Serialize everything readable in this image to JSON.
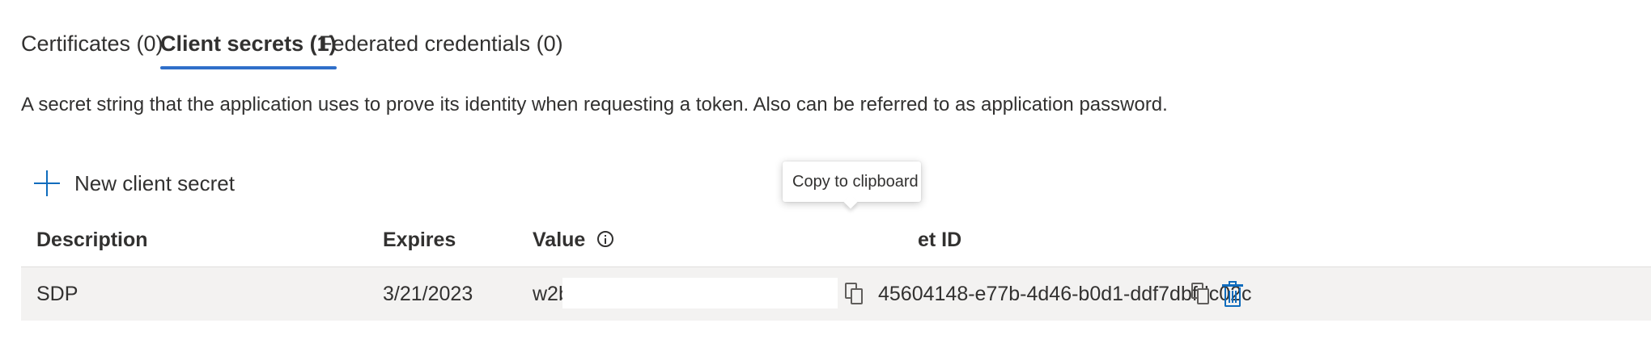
{
  "tabs": [
    {
      "label": "Certificates (0)",
      "active": false
    },
    {
      "label": "Client secrets (1)",
      "active": true
    },
    {
      "label": "Federated credentials (0)",
      "active": false
    }
  ],
  "description": "A secret string that the application uses to prove its identity when requesting a token. Also can be referred to as application password.",
  "new_secret_label": "New client secret",
  "table": {
    "headers": {
      "description": "Description",
      "expires": "Expires",
      "value": "Value",
      "secret_id_partial": "et ID"
    },
    "rows": [
      {
        "description": "SDP",
        "expires": "3/21/2023",
        "value_visible": "w2b",
        "secret_id": "45604148-e77b-4d46-b0d1-ddf7dbfdc02c"
      }
    ]
  },
  "tooltip": "Copy to clipboard",
  "colors": {
    "accent": "#0f6cbd",
    "tab_underline": "#2f6fc9",
    "row_background": "#f3f2f1"
  },
  "icons": [
    "plus-icon",
    "info-icon",
    "copy-icon",
    "delete-icon"
  ]
}
